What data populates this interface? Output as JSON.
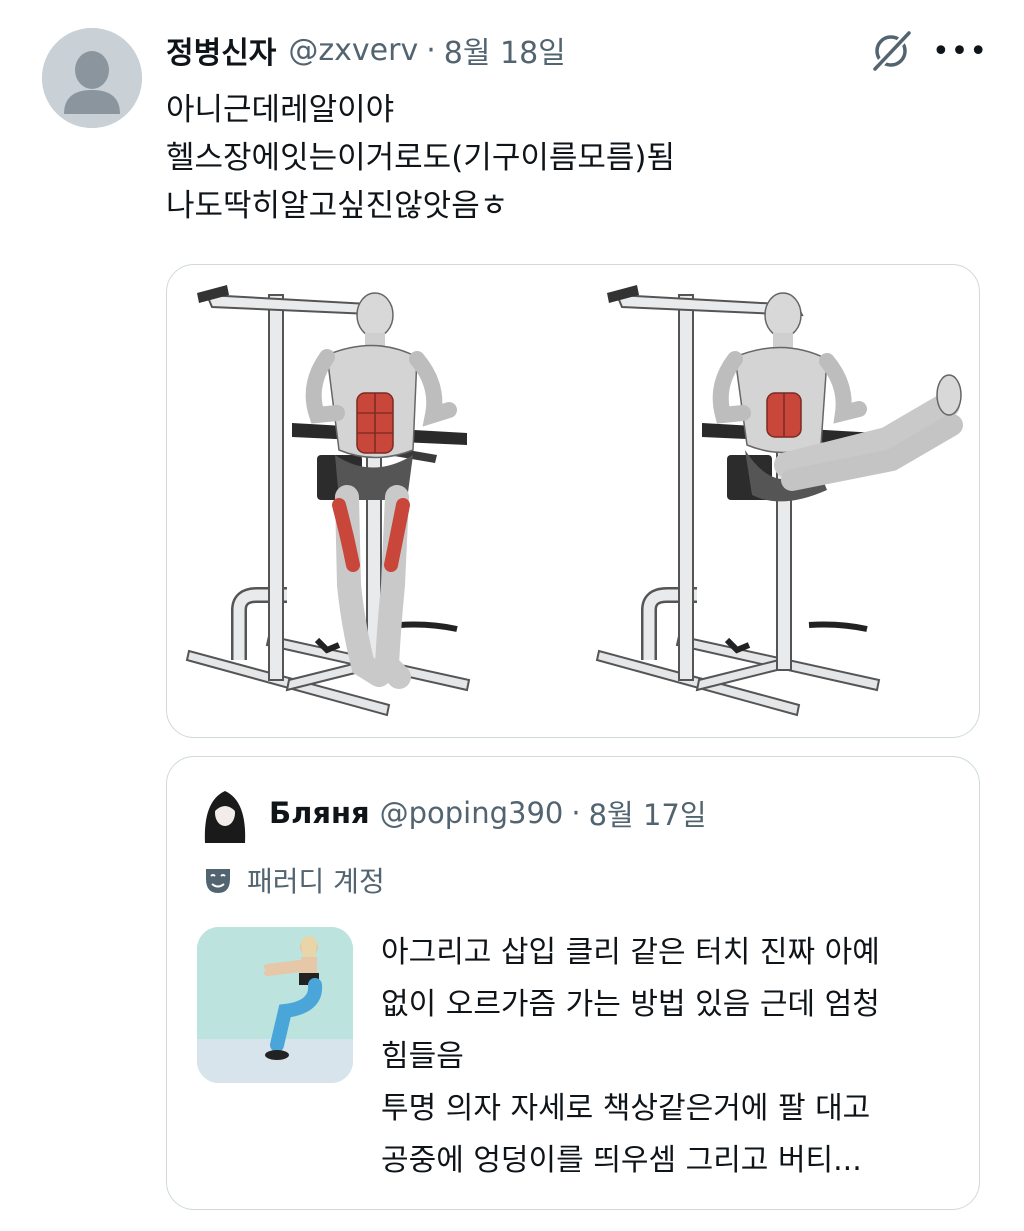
{
  "tweet": {
    "display_name": "정병신자",
    "handle": "@zxverv",
    "separator": "·",
    "date": "8월 18일",
    "icons": {
      "grok": "grok-icon",
      "more": "more-icon"
    },
    "more_label": "•••",
    "lines": [
      "아니근데레알이야",
      "헬스장에잇는이거로도(기구이름모름)됨",
      "나도딱히알고싶진않앗음ㅎ"
    ]
  },
  "quoted": {
    "display_name": "Бляня",
    "handle": "@poping390",
    "separator": "·",
    "date": "8월 17일",
    "parody_icon": "mask-icon",
    "parody_label": "패러디 계정",
    "lines": [
      "아그리고 삽입 클리 같은 터치 진짜 아예",
      "없이 오르가즘 가는 방법 있음 근데 엄청",
      "힘들음",
      "투명 의자 자세로 책상같은거에 팔 대고",
      "공중에 엉덩이를 띄우셈 그리고 버티..."
    ]
  },
  "colors": {
    "text": "#0f1419",
    "secondary": "#536471",
    "border": "#cfd9de",
    "muscle_red": "#c8473a"
  }
}
